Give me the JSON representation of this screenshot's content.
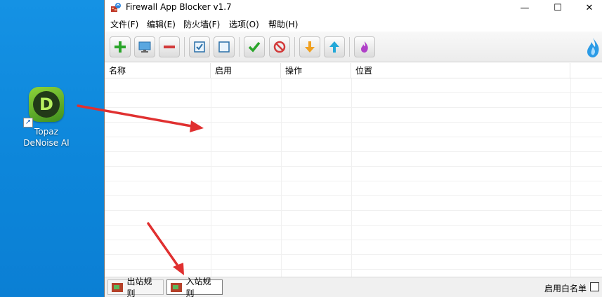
{
  "desktop": {
    "icon_label_line1": "Topaz",
    "icon_label_line2": "DeNoise AI",
    "icon_letter": "D"
  },
  "window": {
    "title": "Firewall App Blocker v1.7",
    "controls": {
      "minimize": "—",
      "maximize": "☐",
      "close": "✕"
    }
  },
  "menu": {
    "items": [
      "文件(F)",
      "编辑(E)",
      "防火墙(F)",
      "选项(O)",
      "帮助(H)"
    ]
  },
  "toolbar": {
    "buttons": [
      "add-icon",
      "monitor-icon",
      "remove-icon",
      "checkbox-checked-icon",
      "checkbox-empty-icon",
      "allow-check-icon",
      "block-icon",
      "download-arrow-icon",
      "upload-arrow-icon",
      "flame-icon"
    ],
    "brand_icon": "drop-flame-icon"
  },
  "table": {
    "columns": [
      "名称",
      "启用",
      "操作",
      "位置"
    ],
    "rows": []
  },
  "statusbar": {
    "tabs": [
      "出站规则",
      "入站规则"
    ],
    "active_tab": "入站规则",
    "whitelist_label": "启用白名单"
  },
  "colors": {
    "desktop_bg": "#0f82d8",
    "annotation_arrow": "#e03030",
    "add_green": "#2aa52a",
    "remove_red": "#d23a3a"
  }
}
